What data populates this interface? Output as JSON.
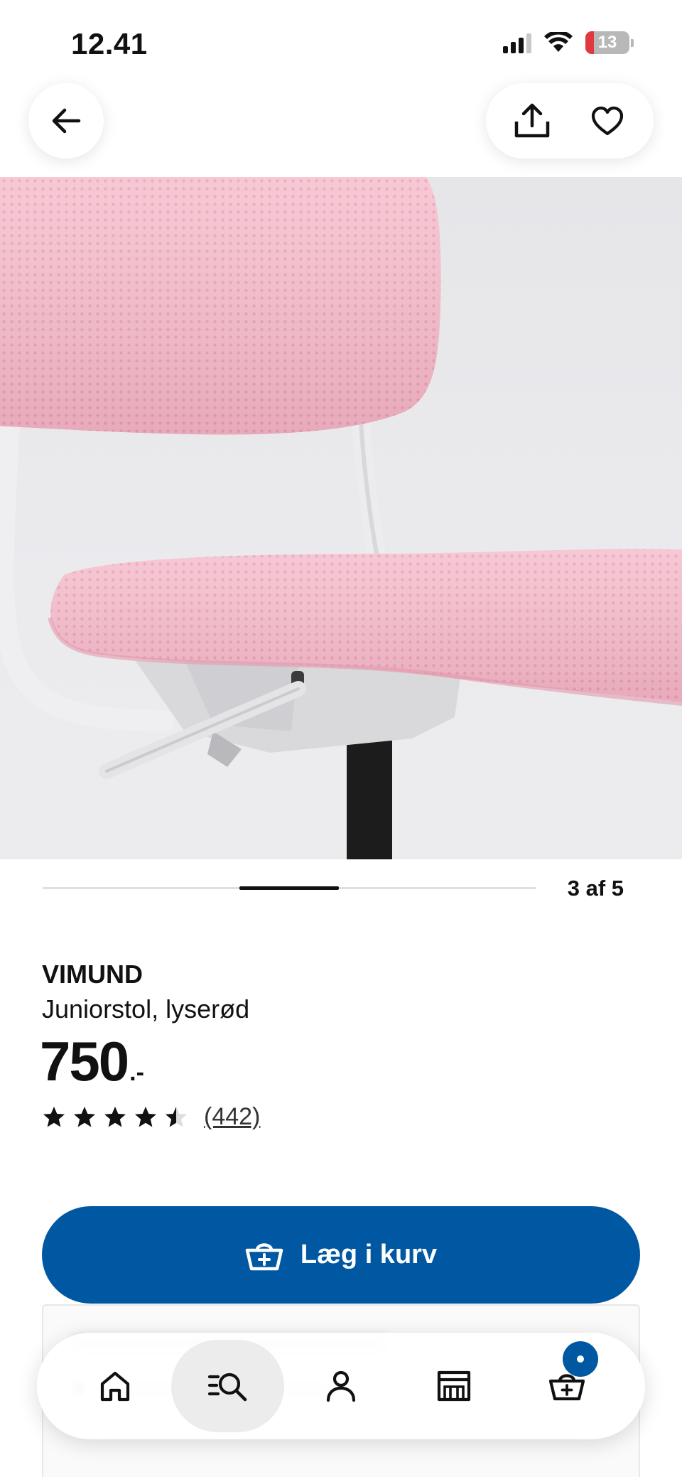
{
  "status_bar": {
    "time": "12.41",
    "battery_level": "13",
    "icons": [
      "cellular-signal-icon",
      "wifi-icon",
      "battery-icon"
    ]
  },
  "top_nav": {
    "back_icon": "arrow-left-icon",
    "share_icon": "share-upload-icon",
    "favorite_icon": "heart-outline-icon"
  },
  "gallery": {
    "image_subject": "pink junior desk chair seat detail",
    "counter_text": "3 af 5",
    "current": 3,
    "total": 5
  },
  "product": {
    "brand": "VIMUND",
    "description": "Juniorstol, lyserød",
    "price_integer": "750",
    "price_suffix": ".-",
    "rating_value": 4.5,
    "rating_max": 5,
    "review_count": "(442)"
  },
  "cta": {
    "add_to_cart_label": "Læg i kurv",
    "add_to_cart_icon": "basket-plus-icon"
  },
  "bottom_nav": {
    "items": [
      "home-icon",
      "search-list-icon",
      "profile-icon",
      "store-icon",
      "cart-icon"
    ],
    "selected": "search-list-icon"
  },
  "colors": {
    "primary_blue": "#0058a3",
    "battery_low": "#e0383e",
    "chair_pink": "#f2b8c6",
    "background": "#ffffff"
  }
}
